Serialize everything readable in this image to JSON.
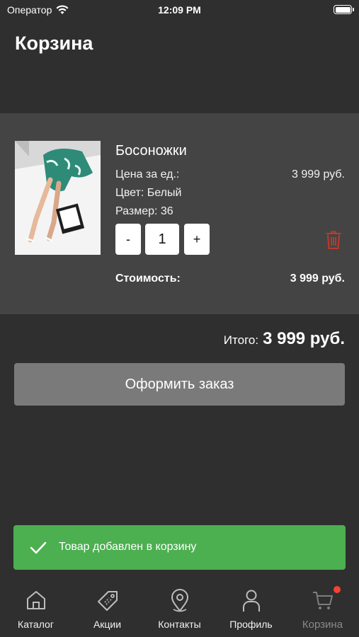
{
  "status_bar": {
    "carrier": "Оператор",
    "time": "12:09 PM"
  },
  "page": {
    "title": "Корзина"
  },
  "cart": {
    "items": [
      {
        "name": "Босоножки",
        "price_label": "Цена за ед.:",
        "price_value": "3 999 руб.",
        "color": "Цвет: Белый",
        "size": "Размер: 36",
        "qty_minus": "-",
        "quantity": "1",
        "qty_plus": "+",
        "cost_label": "Стоимость:",
        "cost_value": "3 999 руб."
      }
    ],
    "total_label": "Итого:",
    "total_value": "3 999 руб.",
    "checkout_label": "Оформить заказ"
  },
  "toast": {
    "message": "Товар добавлен в корзину"
  },
  "tabs": [
    {
      "label": "Каталог",
      "icon": "home-icon"
    },
    {
      "label": "Акции",
      "icon": "tag-icon"
    },
    {
      "label": "Контакты",
      "icon": "location-pin-icon"
    },
    {
      "label": "Профиль",
      "icon": "person-icon"
    },
    {
      "label": "Корзина",
      "icon": "cart-icon",
      "active": true
    }
  ],
  "colors": {
    "background": "#2f2f2f",
    "card": "#444444",
    "button_disabled": "#7a7a7a",
    "toast": "#4caf50",
    "delete": "#c0392b",
    "badge": "#f44336"
  }
}
